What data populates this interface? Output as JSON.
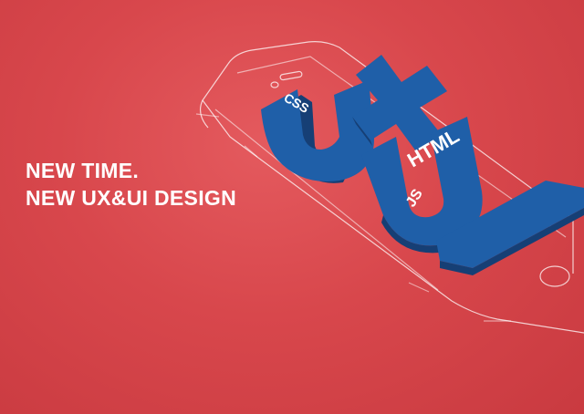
{
  "headline": {
    "line1": "NEW TIME.",
    "line2": "NEW UX&UI DESIGN"
  },
  "artwork": {
    "big_letters_top": "UX",
    "big_letters_bottom": "UI",
    "tag_css": "CSS",
    "tag_html": "HTML",
    "tag_js": "JS"
  },
  "colors": {
    "background": "#d8474c",
    "letters": "#1f5fa8",
    "letters_side": "#163f75",
    "outline": "#ffffff"
  }
}
